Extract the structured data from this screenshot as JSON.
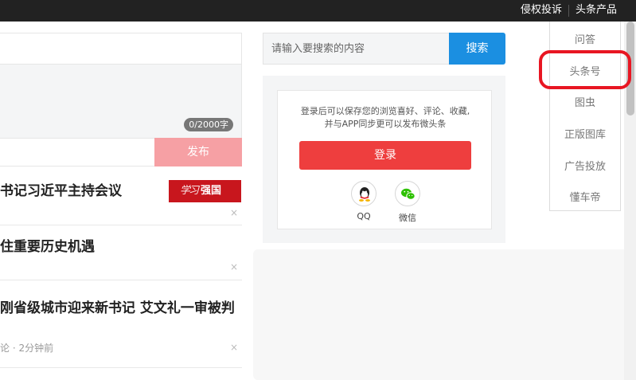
{
  "topbar": {
    "report_label": "侵权投诉",
    "products_label": "头条产品"
  },
  "editor": {
    "counter": "0/2000字",
    "publish_label": "发布"
  },
  "news": [
    {
      "title": "书记习近平主持会议",
      "brand": "学习强国",
      "brand_prefix": "学习",
      "brand_suffix": "强国"
    },
    {
      "title": "住重要历史机遇"
    },
    {
      "title": "刚省级城市迎来新书记 艾文礼一审被判",
      "meta": "论 · 2分钟前"
    }
  ],
  "close_icon_glyph": "×",
  "search": {
    "placeholder": "请输入要搜索的内容",
    "button_label": "搜索"
  },
  "login": {
    "text_line1": "登录后可以保存您的浏览喜好、评论、收藏,",
    "text_line2": "并与APP同步更可以发布微头条",
    "button_label": "登录",
    "qq_label": "QQ",
    "wechat_label": "微信"
  },
  "products_menu": [
    "问答",
    "头条号",
    "图虫",
    "正版图库",
    "广告投放",
    "懂车帝"
  ],
  "colors": {
    "topbar_bg": "#222222",
    "search_blue": "#1b8fe1",
    "login_red": "#ee3e3e",
    "publish_pink": "#f6a0a4",
    "annotation_red": "#e81622",
    "brand_red": "#c8161d",
    "qq_blue": "#12b7f5",
    "wechat_green": "#2dc100"
  }
}
